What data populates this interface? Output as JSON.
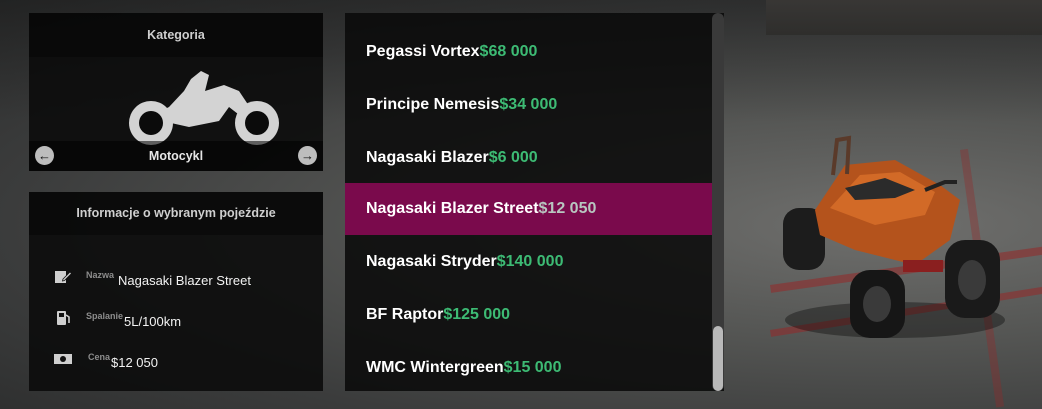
{
  "category": {
    "title": "Kategoria",
    "current": "Motocykl",
    "icon": "motorcycle-icon"
  },
  "info": {
    "title": "Informacje o wybranym pojeździe",
    "rows": [
      {
        "label": "Nazwa",
        "value": "Nagasaki Blazer Street",
        "icon": "edit-icon"
      },
      {
        "label": "Spalanie",
        "value": "5L/100km",
        "icon": "fuel-icon"
      },
      {
        "label": "Cena",
        "value": "$12 050",
        "icon": "cash-icon"
      }
    ]
  },
  "vehicles": [
    {
      "name": "Pegassi Vortex",
      "price": "$68 000"
    },
    {
      "name": "Principe Nemesis",
      "price": "$34 000"
    },
    {
      "name": "Nagasaki Blazer",
      "price": "$6 000"
    },
    {
      "name": "Nagasaki Blazer Street",
      "price": "$12 050"
    },
    {
      "name": "Nagasaki Stryder",
      "price": "$140 000"
    },
    {
      "name": "BF Raptor",
      "price": "$125 000"
    },
    {
      "name": "WMC Wintergreen",
      "price": "$15 000"
    }
  ],
  "selected_index": 3,
  "colors": {
    "accent": "#7a0a4c",
    "price": "#3dbb74"
  }
}
